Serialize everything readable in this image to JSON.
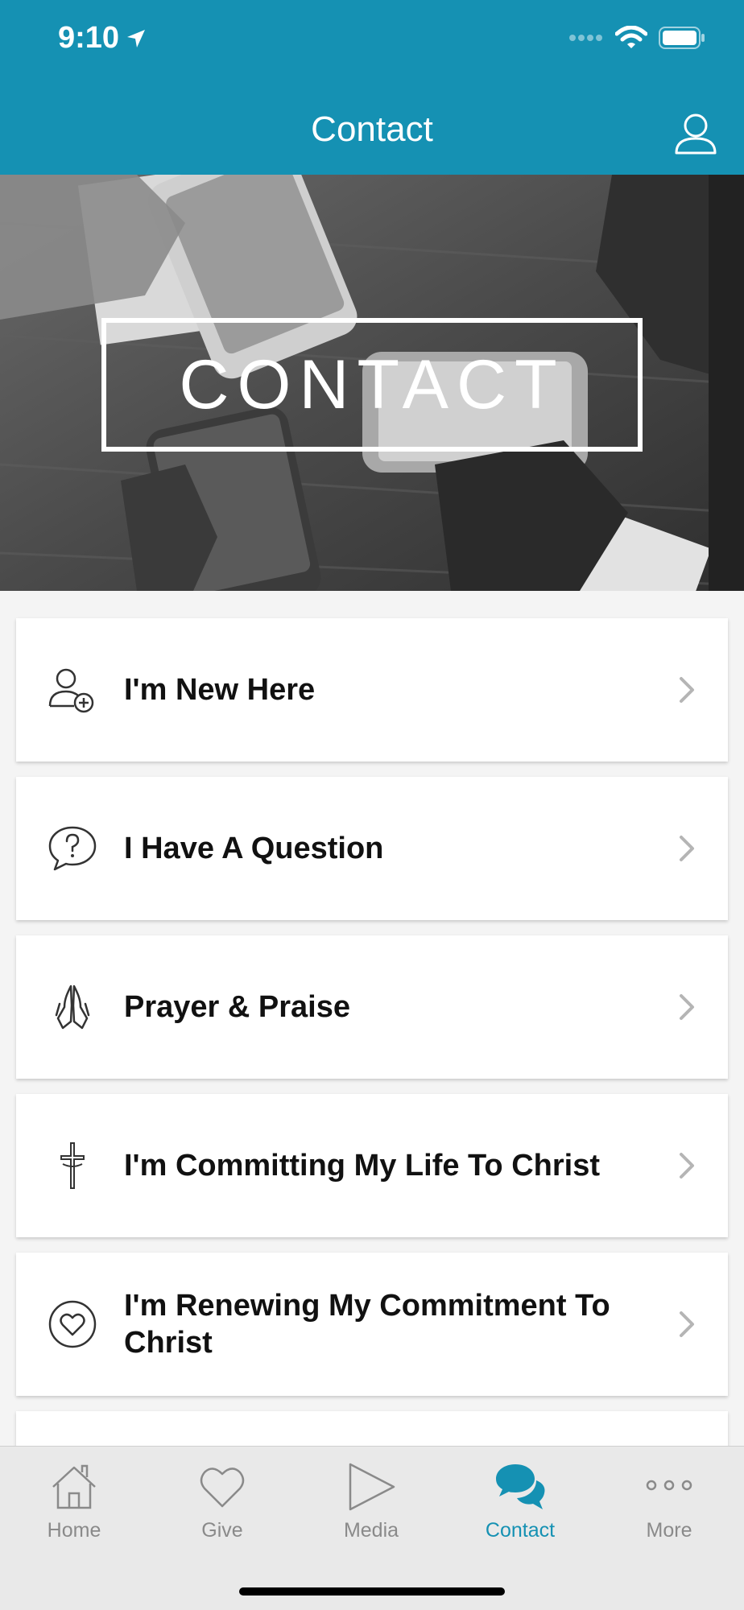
{
  "status_bar": {
    "time": "9:10"
  },
  "header": {
    "title": "Contact"
  },
  "hero": {
    "text": "CONTACT"
  },
  "list": {
    "items": [
      {
        "label": "I'm New Here",
        "icon": "person-add-icon"
      },
      {
        "label": "I Have A Question",
        "icon": "question-bubble-icon"
      },
      {
        "label": "Prayer & Praise",
        "icon": "praying-hands-icon"
      },
      {
        "label": "I'm Committing My Life To Christ",
        "icon": "cross-icon"
      },
      {
        "label": "I'm Renewing My Commitment To Christ",
        "icon": "heart-circle-icon"
      }
    ]
  },
  "tabs": [
    {
      "label": "Home",
      "icon": "home-icon"
    },
    {
      "label": "Give",
      "icon": "heart-icon"
    },
    {
      "label": "Media",
      "icon": "play-icon"
    },
    {
      "label": "Contact",
      "icon": "chat-bubbles-icon",
      "active": true
    },
    {
      "label": "More",
      "icon": "more-dots-icon"
    }
  ],
  "colors": {
    "accent": "#1591b3",
    "tab_inactive": "#8a8a8a",
    "tabbar_bg": "#e9e9e9"
  }
}
